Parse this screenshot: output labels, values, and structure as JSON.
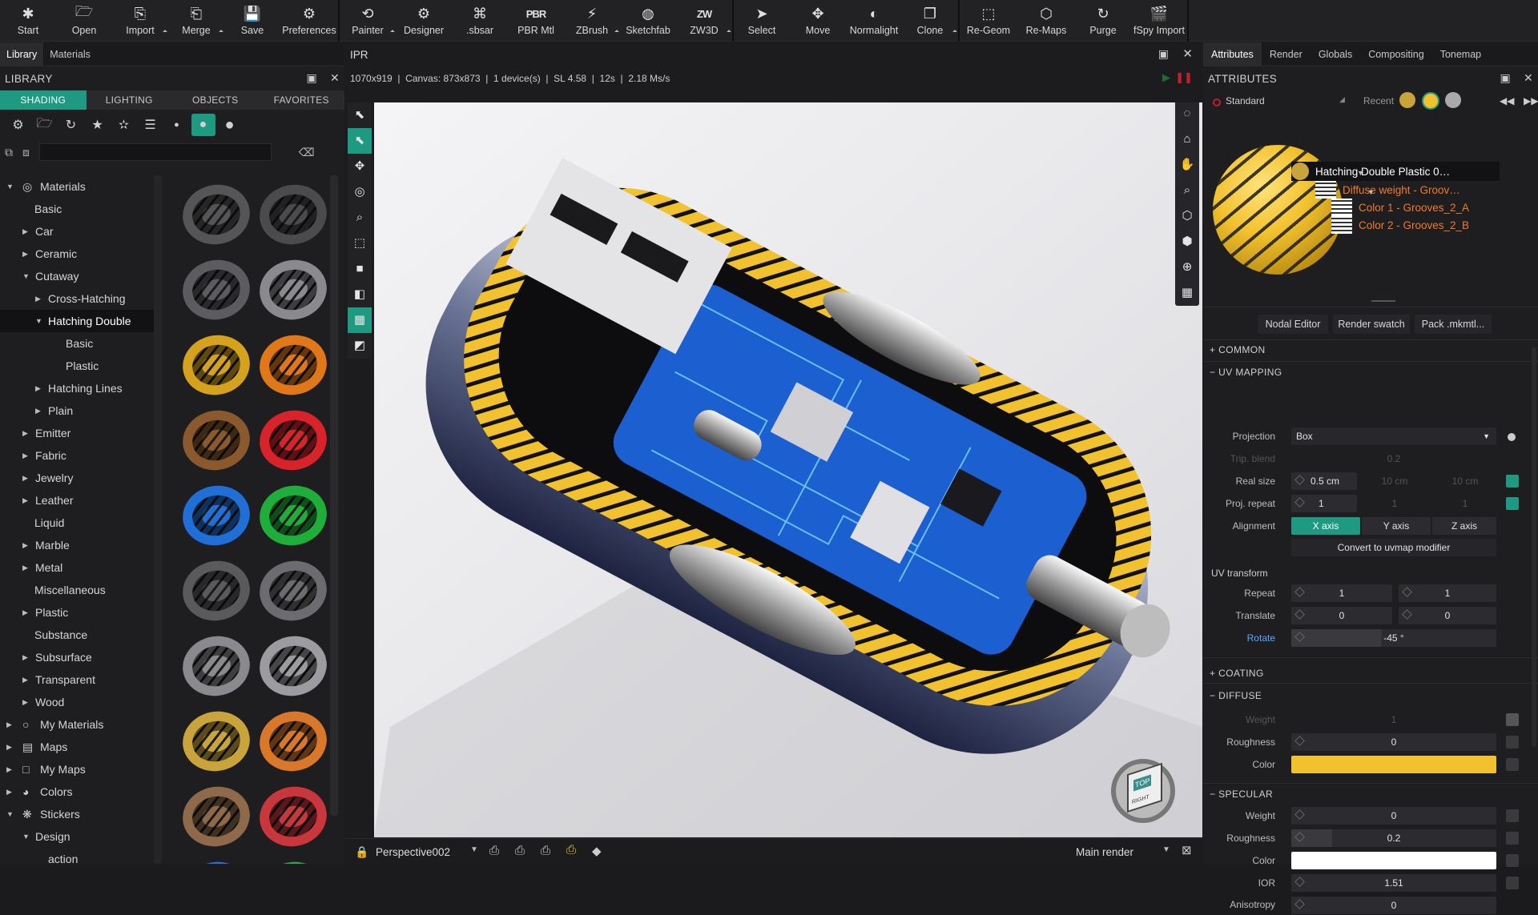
{
  "toolbar": {
    "groups": [
      [
        {
          "label": "Start",
          "icon": "start-icon",
          "glyph": "✱"
        },
        {
          "label": "Open",
          "icon": "folder-open-icon",
          "glyph": "🗁"
        },
        {
          "label": "Import",
          "icon": "import-icon",
          "glyph": "⎘"
        },
        {
          "label": "Merge",
          "icon": "merge-icon",
          "glyph": "⎗"
        },
        {
          "label": "Save",
          "icon": "save-icon",
          "glyph": "💾"
        },
        {
          "label": "Preferences",
          "icon": "gear-icon",
          "glyph": "⚙"
        }
      ],
      [
        {
          "label": "Painter",
          "icon": "painter-icon",
          "glyph": "⟲"
        },
        {
          "label": "Designer",
          "icon": "designer-icon",
          "glyph": "⚙"
        },
        {
          "label": ".sbsar",
          "icon": "sbsar-icon",
          "glyph": "⌘"
        },
        {
          "label": "PBR Mtl",
          "icon": "pbr-icon",
          "glyph": "PBR"
        },
        {
          "label": "ZBrush",
          "icon": "zbrush-icon",
          "glyph": "⚡"
        },
        {
          "label": "Sketchfab",
          "icon": "sketchfab-icon",
          "glyph": "◍"
        },
        {
          "label": "ZW3D",
          "icon": "zw3d-icon",
          "glyph": "ZW"
        }
      ],
      [
        {
          "label": "Select",
          "icon": "cursor-icon",
          "glyph": "➤"
        },
        {
          "label": "Move",
          "icon": "move-icon",
          "glyph": "✥"
        },
        {
          "label": "Normalight",
          "icon": "normalight-icon",
          "glyph": "◐"
        },
        {
          "label": "Clone",
          "icon": "clone-icon",
          "glyph": "❐"
        }
      ],
      [
        {
          "label": "Re-Geom",
          "icon": "regeom-icon",
          "glyph": "⬚"
        },
        {
          "label": "Re-Maps",
          "icon": "remaps-icon",
          "glyph": "⬡"
        },
        {
          "label": "Purge",
          "icon": "purge-icon",
          "glyph": "↻"
        },
        {
          "label": "fSpy Import",
          "icon": "fspy-icon",
          "glyph": "🎬"
        }
      ]
    ]
  },
  "left": {
    "tabs": [
      "Library",
      "Materials"
    ],
    "header": "LIBRARY",
    "subtabs": [
      "SHADING",
      "LIGHTING",
      "OBJECTS",
      "FAVORITES"
    ],
    "tree": [
      {
        "label": "Materials",
        "indent": 0,
        "arrow": "down",
        "icon": "materials-icon"
      },
      {
        "label": "Basic",
        "indent": 1,
        "arrow": ""
      },
      {
        "label": "Car",
        "indent": 1,
        "arrow": "right"
      },
      {
        "label": "Ceramic",
        "indent": 1,
        "arrow": "right"
      },
      {
        "label": "Cutaway",
        "indent": 1,
        "arrow": "down"
      },
      {
        "label": "Cross-Hatching",
        "indent": 2,
        "arrow": "right"
      },
      {
        "label": "Hatching Double",
        "indent": 2,
        "arrow": "down",
        "selected": true
      },
      {
        "label": "Basic",
        "indent": 3,
        "arrow": ""
      },
      {
        "label": "Plastic",
        "indent": 3,
        "arrow": ""
      },
      {
        "label": "Hatching Lines",
        "indent": 2,
        "arrow": "right"
      },
      {
        "label": "Plain",
        "indent": 2,
        "arrow": "right"
      },
      {
        "label": "Emitter",
        "indent": 1,
        "arrow": "right"
      },
      {
        "label": "Fabric",
        "indent": 1,
        "arrow": "right"
      },
      {
        "label": "Jewelry",
        "indent": 1,
        "arrow": "right"
      },
      {
        "label": "Leather",
        "indent": 1,
        "arrow": "right"
      },
      {
        "label": "Liquid",
        "indent": 1,
        "arrow": ""
      },
      {
        "label": "Marble",
        "indent": 1,
        "arrow": "right"
      },
      {
        "label": "Metal",
        "indent": 1,
        "arrow": "right"
      },
      {
        "label": "Miscellaneous",
        "indent": 1,
        "arrow": ""
      },
      {
        "label": "Plastic",
        "indent": 1,
        "arrow": "right"
      },
      {
        "label": "Substance",
        "indent": 1,
        "arrow": ""
      },
      {
        "label": "Subsurface",
        "indent": 1,
        "arrow": "right"
      },
      {
        "label": "Transparent",
        "indent": 1,
        "arrow": "right"
      },
      {
        "label": "Wood",
        "indent": 1,
        "arrow": "right"
      },
      {
        "label": "My Materials",
        "indent": 0,
        "arrow": "right",
        "icon": "circle-icon"
      },
      {
        "label": "Maps",
        "indent": 0,
        "arrow": "right",
        "icon": "maps-icon"
      },
      {
        "label": "My Maps",
        "indent": 0,
        "arrow": "right",
        "icon": "square-icon"
      },
      {
        "label": "Colors",
        "indent": 0,
        "arrow": "right",
        "icon": "colors-icon"
      },
      {
        "label": "Stickers",
        "indent": 0,
        "arrow": "down",
        "icon": "stickers-icon"
      },
      {
        "label": "Design",
        "indent": 1,
        "arrow": "down"
      },
      {
        "label": "action",
        "indent": 2,
        "arrow": ""
      }
    ],
    "swatches": [
      "#555558",
      "#4b4b4e",
      "#5c5c60",
      "#8a8a8e",
      "#d4a21c",
      "#e0781a",
      "#8a5a2e",
      "#d8232a",
      "#1f6fd6",
      "#1fae3a",
      "#5a5a5d",
      "#6c6c70",
      "#8a8a8e",
      "#9c9ca0",
      "#c9a43a",
      "#d9782a",
      "#8e6a4a",
      "#c8373c",
      "#2a6fd6",
      "#2aa84a"
    ]
  },
  "ipr": {
    "title": "IPR",
    "status": "1070x919  |  Canvas: 873x873  |  1 device(s)  |  SL 4.58  |  12s  |  2.18 Ms/s",
    "camera": "Perspective002",
    "render_target": "Main render",
    "viewcube_labels": [
      "TOP",
      "RIGHT"
    ]
  },
  "right": {
    "tabs": [
      "Attributes",
      "Render",
      "Globals",
      "Compositing",
      "Tonemap"
    ],
    "header": "ATTRIBUTES",
    "material_type": "Standard",
    "recent_label": "Recent",
    "tree": [
      {
        "label": "Hatching Double Plastic 0…",
        "color": "#ffffff"
      },
      {
        "label": "Diffuse weight - Groov…",
        "color": "#f07a2a"
      },
      {
        "label": "Color 1 - Grooves_2_A",
        "color": "#f07a2a"
      },
      {
        "label": "Color 2 - Grooves_2_B",
        "color": "#f07a2a"
      }
    ],
    "buttons": [
      "Nodal Editor",
      "Render swatch",
      "Pack .mkmtl..."
    ],
    "sections": {
      "common": "COMMON",
      "uv": "UV MAPPING",
      "coating": "COATING",
      "diffuse": "DIFFUSE",
      "specular": "SPECULAR"
    },
    "uv": {
      "projection_label": "Projection",
      "projection": "Box",
      "trip_label": "Trip. blend",
      "trip": "0.2",
      "real_label": "Real size",
      "real": [
        "0.5 cm",
        "10 cm",
        "10 cm"
      ],
      "repeat_label": "Proj. repeat",
      "repeat": [
        "1",
        "1",
        "1"
      ],
      "align_label": "Alignment",
      "axes": [
        "X axis",
        "Y axis",
        "Z axis"
      ],
      "convert": "Convert to uvmap modifier",
      "transform": "UV transform",
      "rep_label": "Repeat",
      "rep": [
        "1",
        "1"
      ],
      "tr_label": "Translate",
      "tr": [
        "0",
        "0"
      ],
      "rot_label": "Rotate",
      "rot": "-45 °"
    },
    "diffuse": {
      "weight_label": "Weight",
      "weight": "1",
      "rough_label": "Roughness",
      "rough": "0",
      "color_label": "Color",
      "color": "#f2c12e"
    },
    "specular": {
      "weight_label": "Weight",
      "weight": "0",
      "rough_label": "Roughness",
      "rough": "0.2",
      "color_label": "Color",
      "color": "#ffffff",
      "ior_label": "IOR",
      "ior": "1.51",
      "aniso_label": "Anisotropy",
      "aniso": "0"
    }
  }
}
